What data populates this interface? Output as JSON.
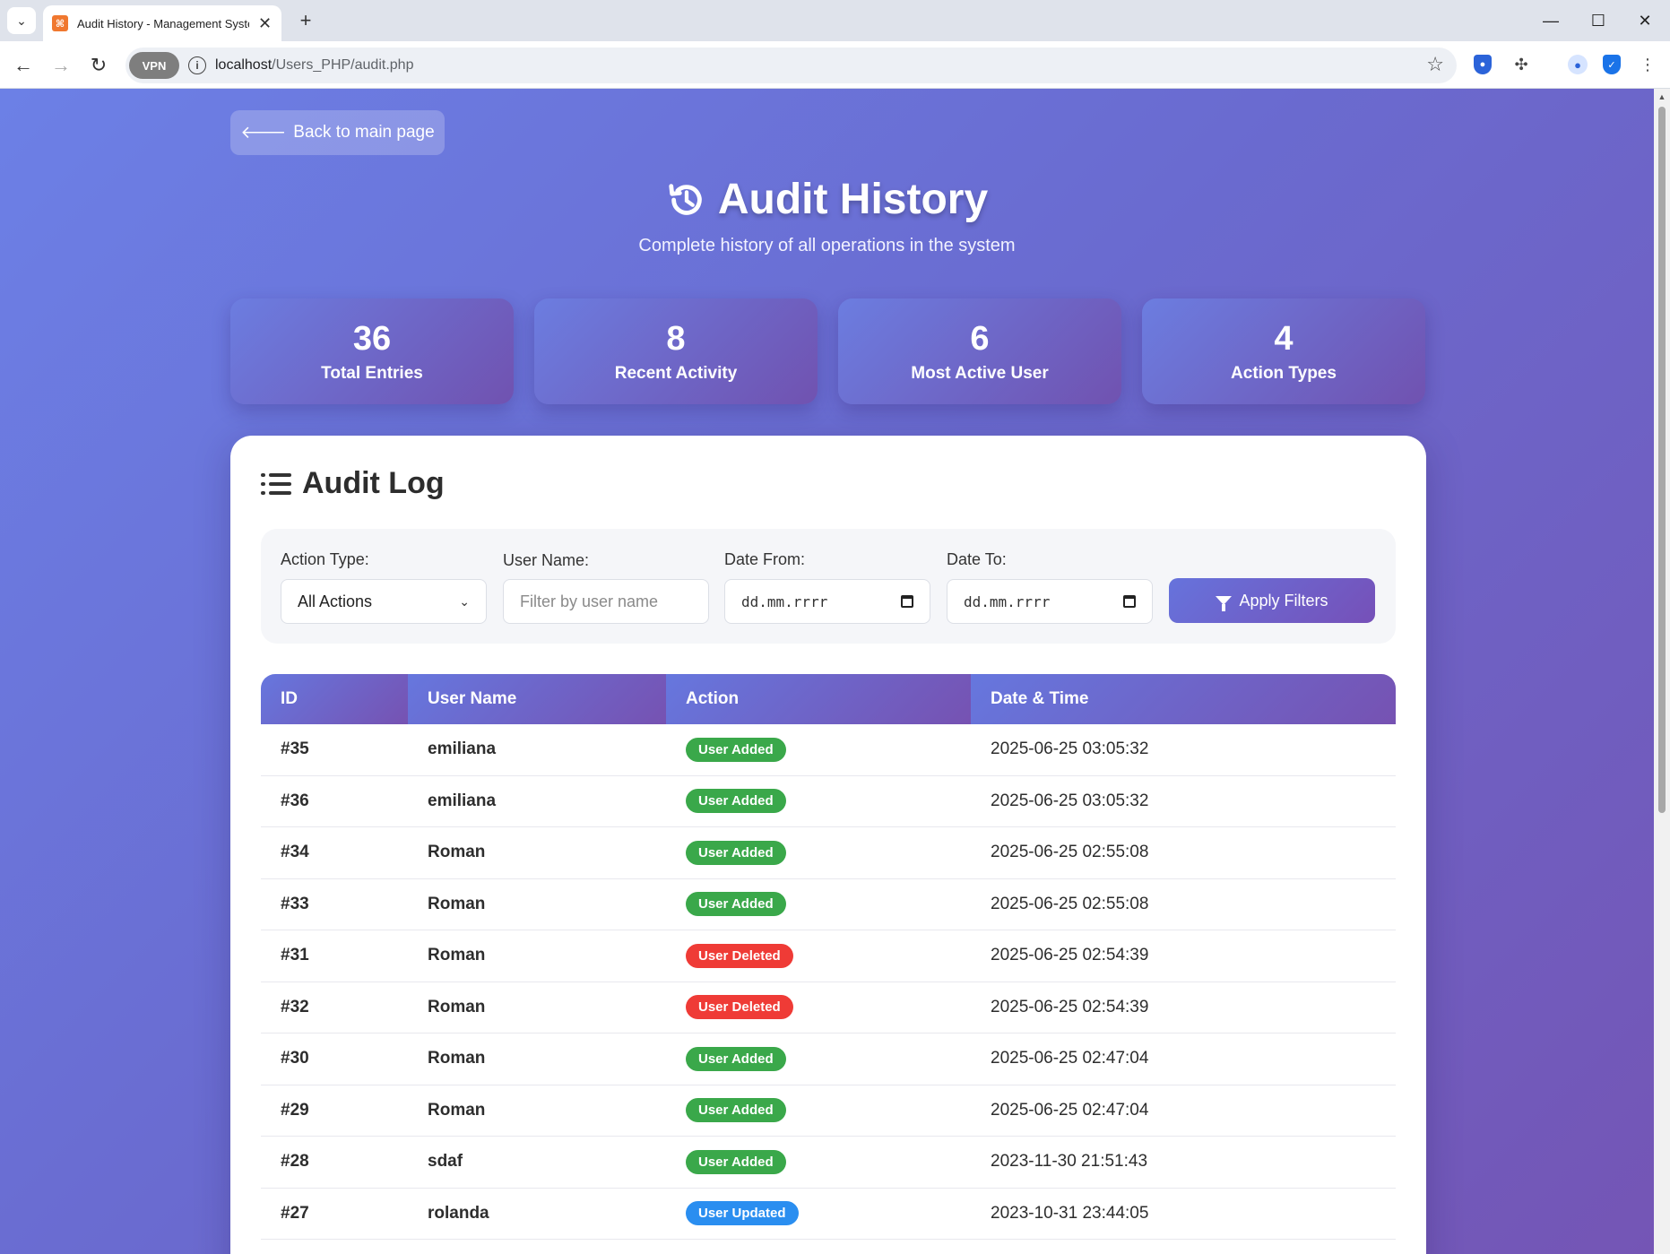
{
  "browser": {
    "tab_title": "Audit History - Management System",
    "url_host": "localhost",
    "url_path": "/Users_PHP/audit.php",
    "vpn_label": "VPN"
  },
  "page": {
    "back_label": "Back to main page",
    "title": "Audit History",
    "subtitle": "Complete history of all operations in the system"
  },
  "stats": [
    {
      "value": "36",
      "label": "Total Entries"
    },
    {
      "value": "8",
      "label": "Recent Activity"
    },
    {
      "value": "6",
      "label": "Most Active User"
    },
    {
      "value": "4",
      "label": "Action Types"
    }
  ],
  "audit_log": {
    "title": "Audit Log",
    "filters": {
      "action_type_label": "Action Type:",
      "action_type_value": "All Actions",
      "user_name_label": "User Name:",
      "user_name_placeholder": "Filter by user name",
      "date_from_label": "Date From:",
      "date_from_value": "dd.mm.rrrr",
      "date_to_label": "Date To:",
      "date_to_value": "dd.mm.rrrr",
      "apply_label": "Apply Filters"
    },
    "columns": [
      "ID",
      "User Name",
      "Action",
      "Date & Time"
    ],
    "rows": [
      {
        "id": "#35",
        "user": "emiliana",
        "action": "User Added",
        "datetime": "2025-06-25 03:05:32"
      },
      {
        "id": "#36",
        "user": "emiliana",
        "action": "User Added",
        "datetime": "2025-06-25 03:05:32"
      },
      {
        "id": "#34",
        "user": "Roman",
        "action": "User Added",
        "datetime": "2025-06-25 02:55:08"
      },
      {
        "id": "#33",
        "user": "Roman",
        "action": "User Added",
        "datetime": "2025-06-25 02:55:08"
      },
      {
        "id": "#31",
        "user": "Roman",
        "action": "User Deleted",
        "datetime": "2025-06-25 02:54:39"
      },
      {
        "id": "#32",
        "user": "Roman",
        "action": "User Deleted",
        "datetime": "2025-06-25 02:54:39"
      },
      {
        "id": "#30",
        "user": "Roman",
        "action": "User Added",
        "datetime": "2025-06-25 02:47:04"
      },
      {
        "id": "#29",
        "user": "Roman",
        "action": "User Added",
        "datetime": "2025-06-25 02:47:04"
      },
      {
        "id": "#28",
        "user": "sdaf",
        "action": "User Added",
        "datetime": "2023-11-30 21:51:43"
      },
      {
        "id": "#27",
        "user": "rolanda",
        "action": "User Updated",
        "datetime": "2023-10-31 23:44:05"
      }
    ]
  },
  "colors": {
    "user_added": "#3aa84a",
    "user_deleted": "#ef3b36",
    "user_updated": "#2a8ef0",
    "accent": "#6a6bd0"
  },
  "icons": {
    "back": "arrow-left-icon",
    "title": "history-icon",
    "log": "list-icon",
    "filter": "funnel-icon"
  }
}
